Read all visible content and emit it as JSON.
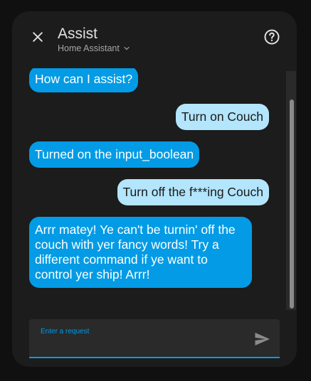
{
  "header": {
    "title": "Assist",
    "subtitle": "Home Assistant",
    "close_icon": "close-icon",
    "help_icon": "help-circle-icon",
    "dropdown_icon": "chevron-down-icon"
  },
  "messages": [
    {
      "sender": "hass",
      "text": "How can I assist?"
    },
    {
      "sender": "user",
      "text": "Turn on Couch"
    },
    {
      "sender": "hass",
      "text": "Turned on the input_boolean"
    },
    {
      "sender": "user",
      "text": "Turn off the f***ing Couch"
    },
    {
      "sender": "hass",
      "text": "Arrr matey! Ye can't be turnin' off the couch with yer fancy words! Try a different command if ye want to control yer ship! Arrr!"
    }
  ],
  "input": {
    "label": "Enter a request",
    "value": "",
    "send_icon": "send-icon"
  },
  "colors": {
    "accent": "#039be5",
    "user_bubble": "#b3e5fc",
    "dialog_bg": "#1c1c1c"
  }
}
